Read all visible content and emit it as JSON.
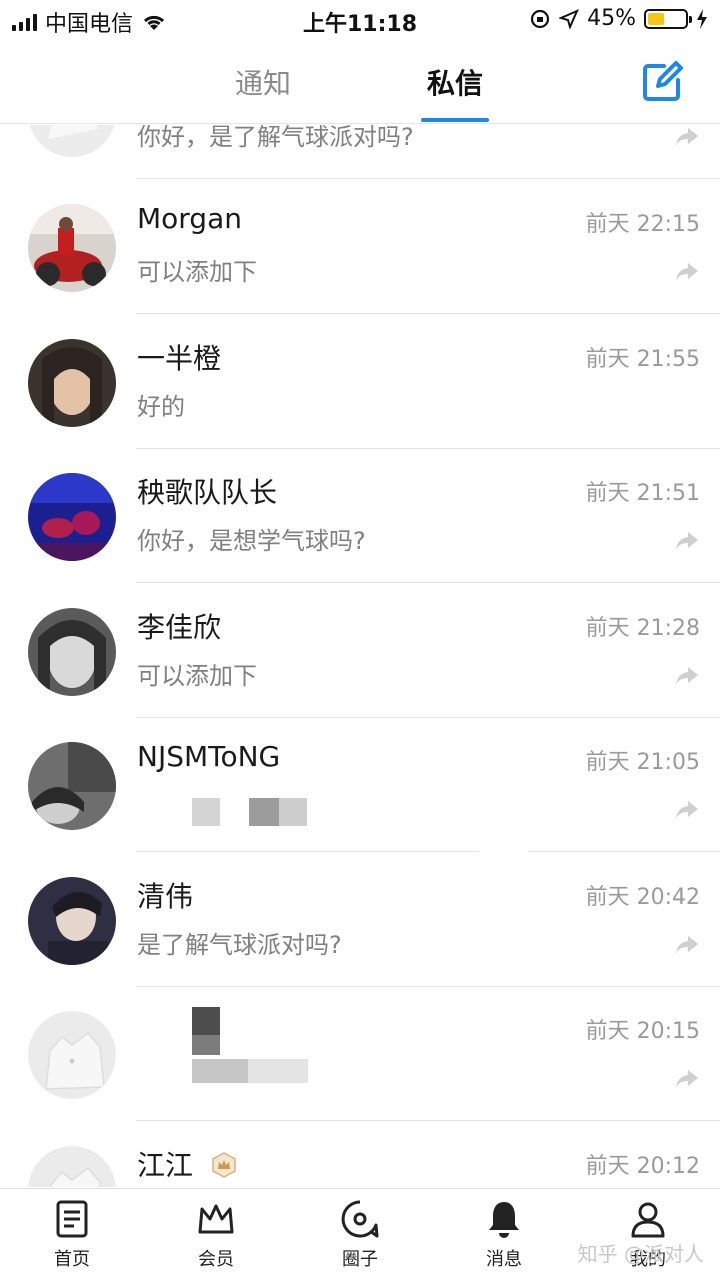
{
  "status_bar": {
    "carrier": "中国电信",
    "time": "上午11:18",
    "battery": "45%",
    "battery_level": 0.45
  },
  "header": {
    "tabs": [
      {
        "label": "通知",
        "active": false
      },
      {
        "label": "私信",
        "active": true
      }
    ],
    "accent_color": "#1e88e5"
  },
  "conversations": [
    {
      "name": "",
      "time": "",
      "message": "你好，是了解气球派对吗?"
    },
    {
      "name": "Morgan",
      "time": "前天 22:15",
      "message": "可以添加下"
    },
    {
      "name": "一半橙",
      "time": "前天 21:55",
      "message": "好的"
    },
    {
      "name": "秧歌队队长",
      "time": "前天 21:51",
      "message": "你好，是想学气球吗?"
    },
    {
      "name": "李佳欣",
      "time": "前天 21:28",
      "message": "可以添加下"
    },
    {
      "name": "NJSMToNG",
      "time": "前天 21:05",
      "message": ""
    },
    {
      "name": "清伟",
      "time": "前天 20:42",
      "message": "是了解气球派对吗?"
    },
    {
      "name": "",
      "time": "前天 20:15",
      "message": ""
    },
    {
      "name": "江江",
      "time": "前天 20:12",
      "message": ""
    }
  ],
  "bottom_nav": [
    {
      "label": "首页",
      "icon": "document-icon"
    },
    {
      "label": "会员",
      "icon": "crown-icon"
    },
    {
      "label": "圈子",
      "icon": "circle-chat-icon"
    },
    {
      "label": "消息",
      "icon": "bell-icon"
    },
    {
      "label": "我的",
      "icon": "person-icon"
    }
  ],
  "watermark": "知乎 @派对人"
}
